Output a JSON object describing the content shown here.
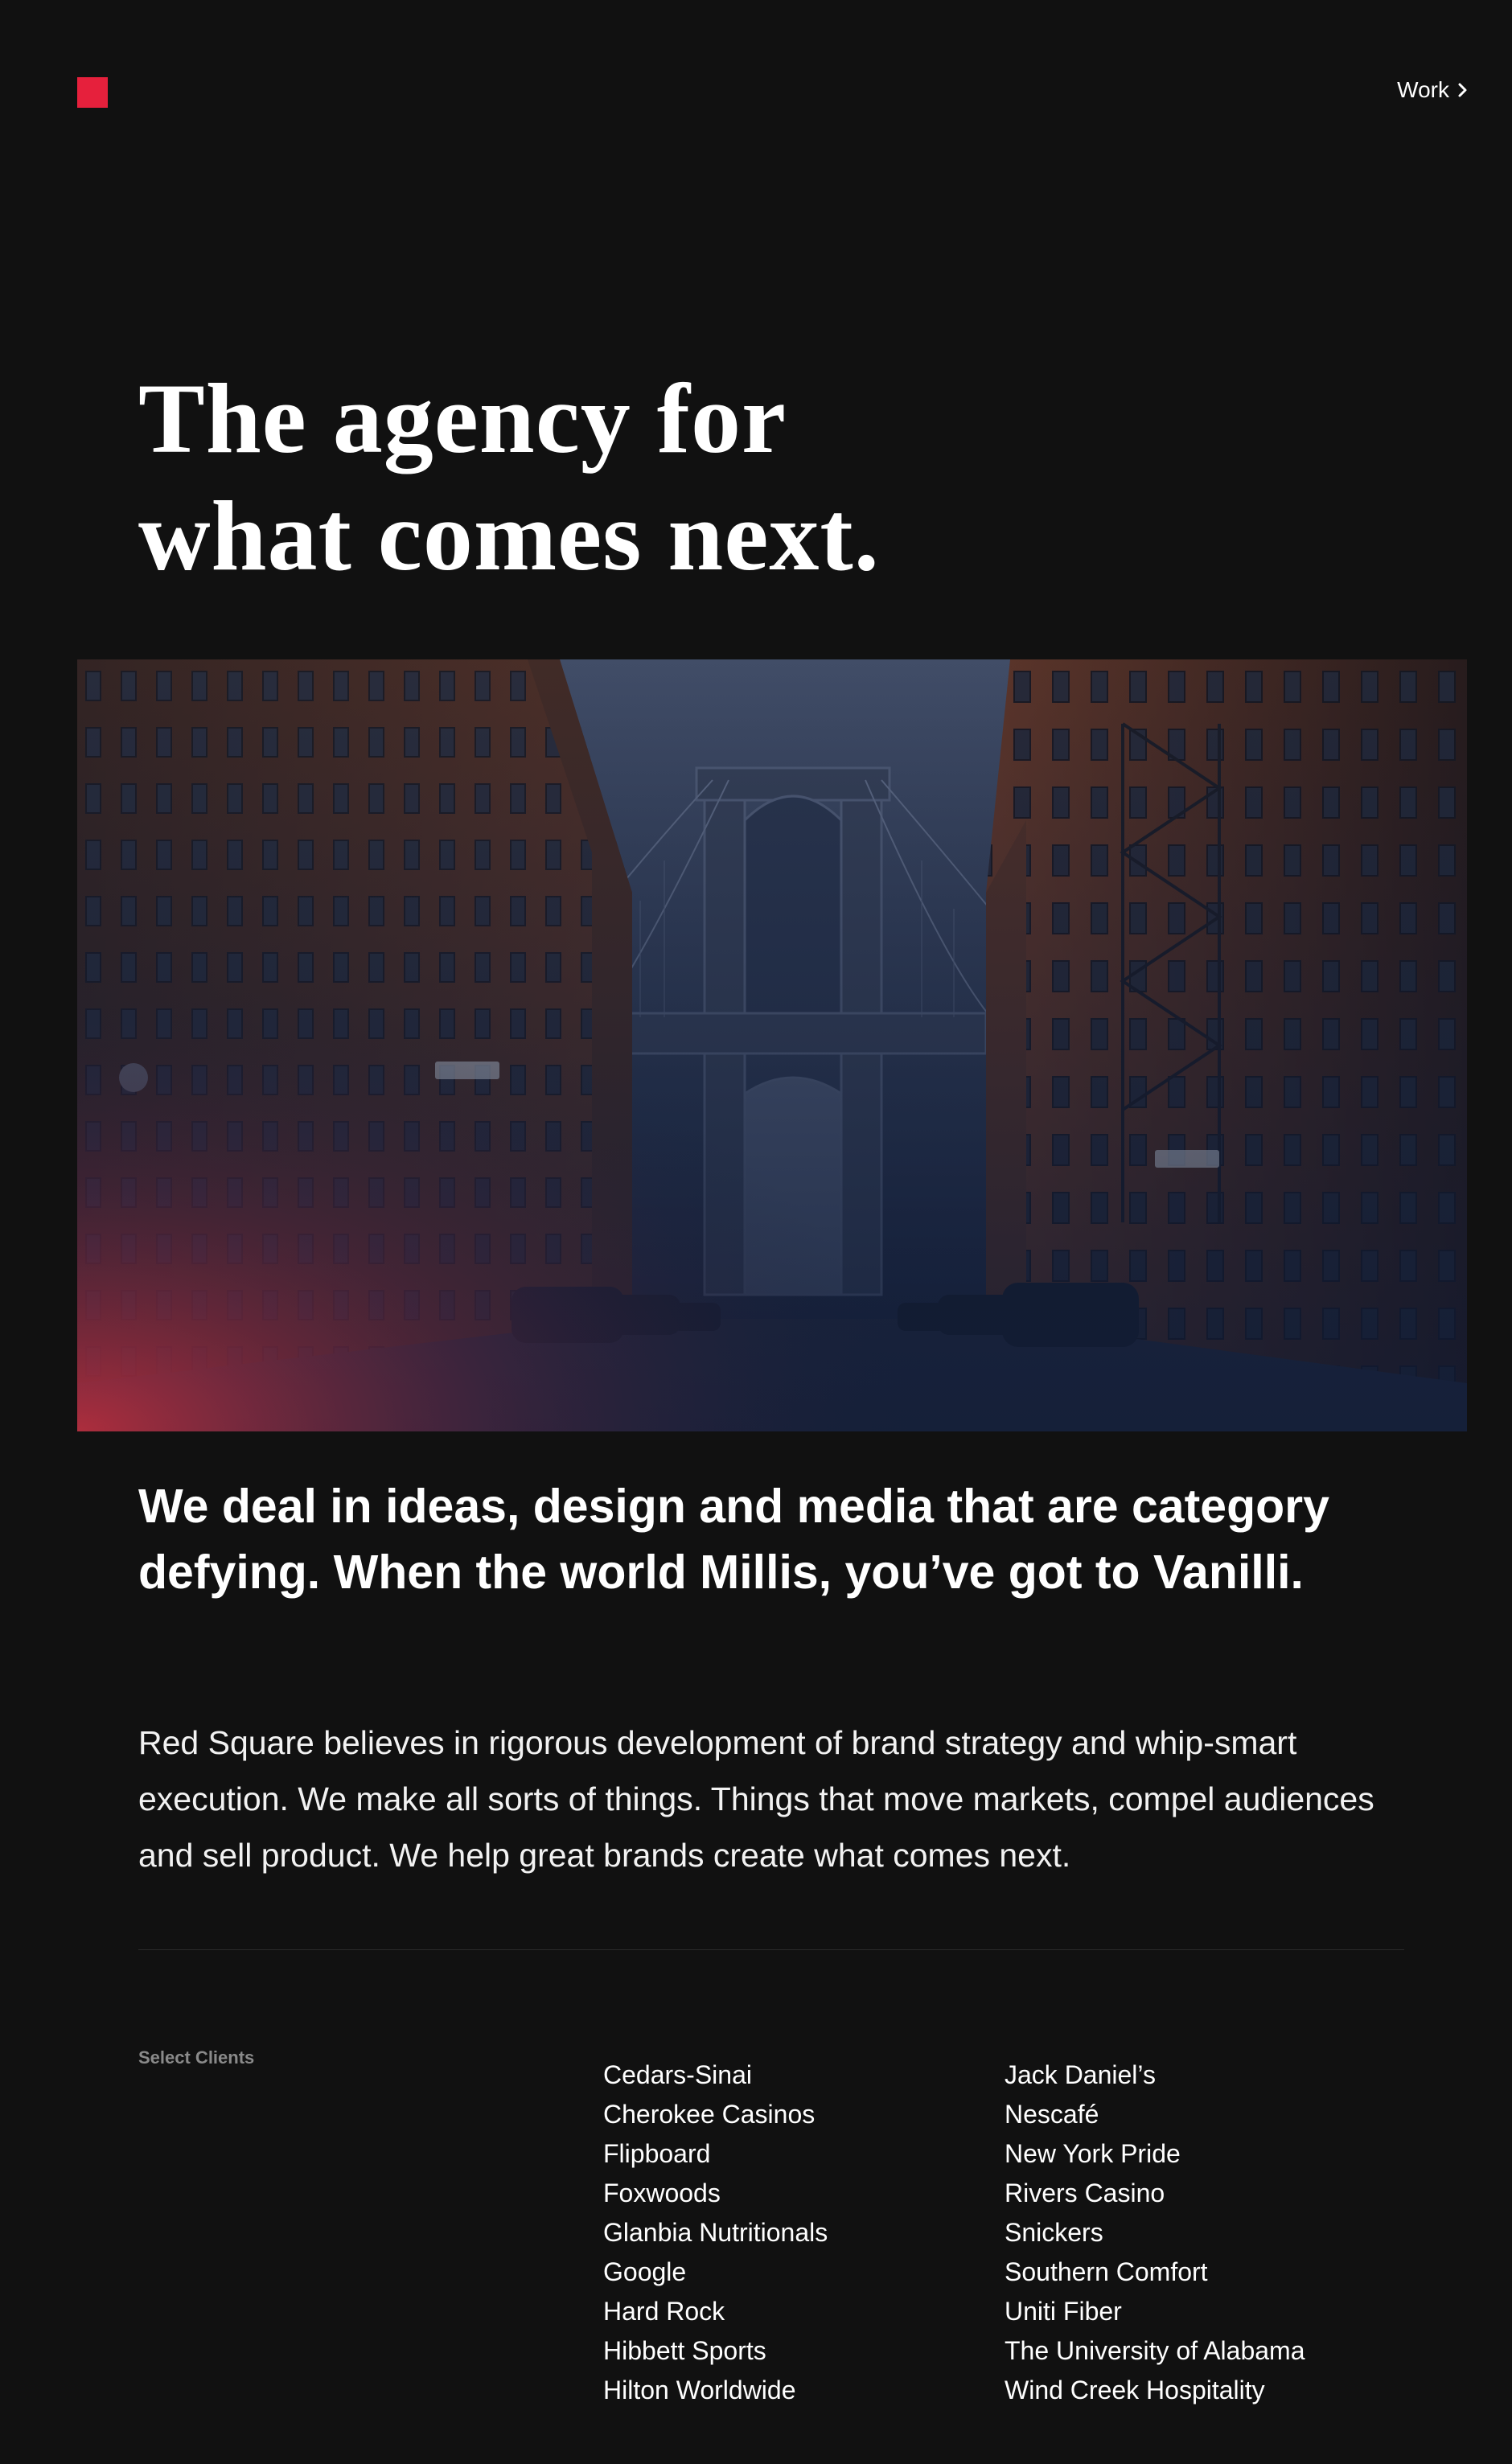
{
  "header": {
    "logo_color": "#e6203c",
    "nav_label": "Work",
    "nav_icon": "chevron-right-icon"
  },
  "hero": {
    "title_line1": "The agency for",
    "title_line2": "what comes next.",
    "image_description_icon": "brooklyn-bridge-street-photo"
  },
  "intro": {
    "tagline": "We deal in ideas, design and media that are category defying. When the world Millis, you’ve got to Vanilli.",
    "body": "Red Square believes in rigorous development of brand strategy and whip-smart execution. We make all sorts of things. Things that move markets, compel audiences and sell product. We help great brands create what comes next."
  },
  "clients": {
    "label": "Select Clients",
    "column1": [
      "Cedars-Sinai",
      "Cherokee Casinos",
      "Flipboard",
      "Foxwoods",
      "Glanbia Nutritionals",
      "Google",
      "Hard Rock",
      "Hibbett Sports",
      "Hilton Worldwide"
    ],
    "column2": [
      "Jack Daniel’s",
      "Nescafé",
      "New York Pride",
      "Rivers Casino",
      "Snickers",
      "Southern Comfort",
      "Uniti Fiber",
      "The University of Alabama",
      "Wind Creek Hospitality"
    ]
  },
  "colors": {
    "background": "#111111",
    "accent": "#e6203c",
    "muted_label": "#8a8a8a"
  }
}
